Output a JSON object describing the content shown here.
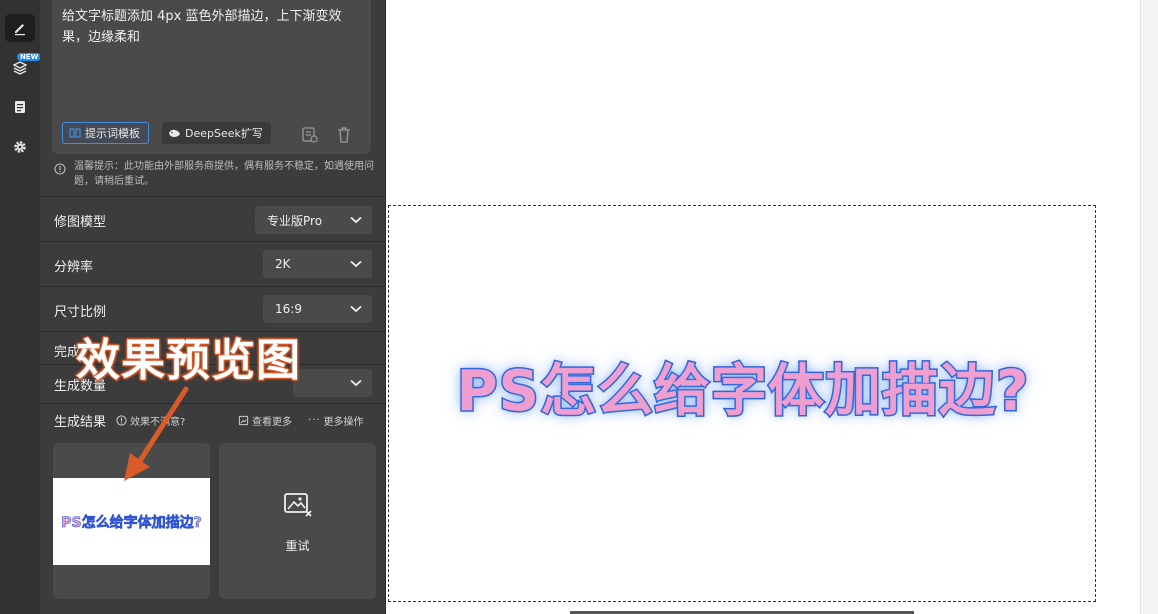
{
  "sidebar": {
    "icons": [
      "edit-icon",
      "layers-icon",
      "clipboard-icon",
      "settings-icon"
    ],
    "new_badge": "NEW"
  },
  "prompt": {
    "text": "给文字标题添加 4px 蓝色外部描边，上下渐变效果，边缘柔和",
    "template_label": "提示词模板",
    "deepseek_label": "DeepSeek扩写"
  },
  "notice": "温馨提示：此功能由外部服务商提供，偶有服务不稳定，如遇使用问题，请稍后重试。",
  "settings": {
    "model": {
      "label": "修图模型",
      "value": "专业版Pro"
    },
    "resolution": {
      "label": "分辨率",
      "value": "2K"
    },
    "aspect": {
      "label": "尺寸比例",
      "value": "16:9"
    },
    "complete_label": "完成",
    "count_label": "生成数量"
  },
  "results": {
    "label": "生成结果",
    "unsatisfied": "效果不满意?",
    "view_more": "查看更多",
    "more_actions": "更多操作",
    "thumb_text": "PS怎么给字体加描边?",
    "retry_label": "重试"
  },
  "annotation": "效果预览图",
  "canvas": {
    "title": "PS怎么给字体加描边?"
  },
  "colors": {
    "accent": "#3f8ee0",
    "stroke_blue": "#2e5fd8",
    "text_pink": "#ee9fcf",
    "annotation_orange": "#d95b2a"
  }
}
